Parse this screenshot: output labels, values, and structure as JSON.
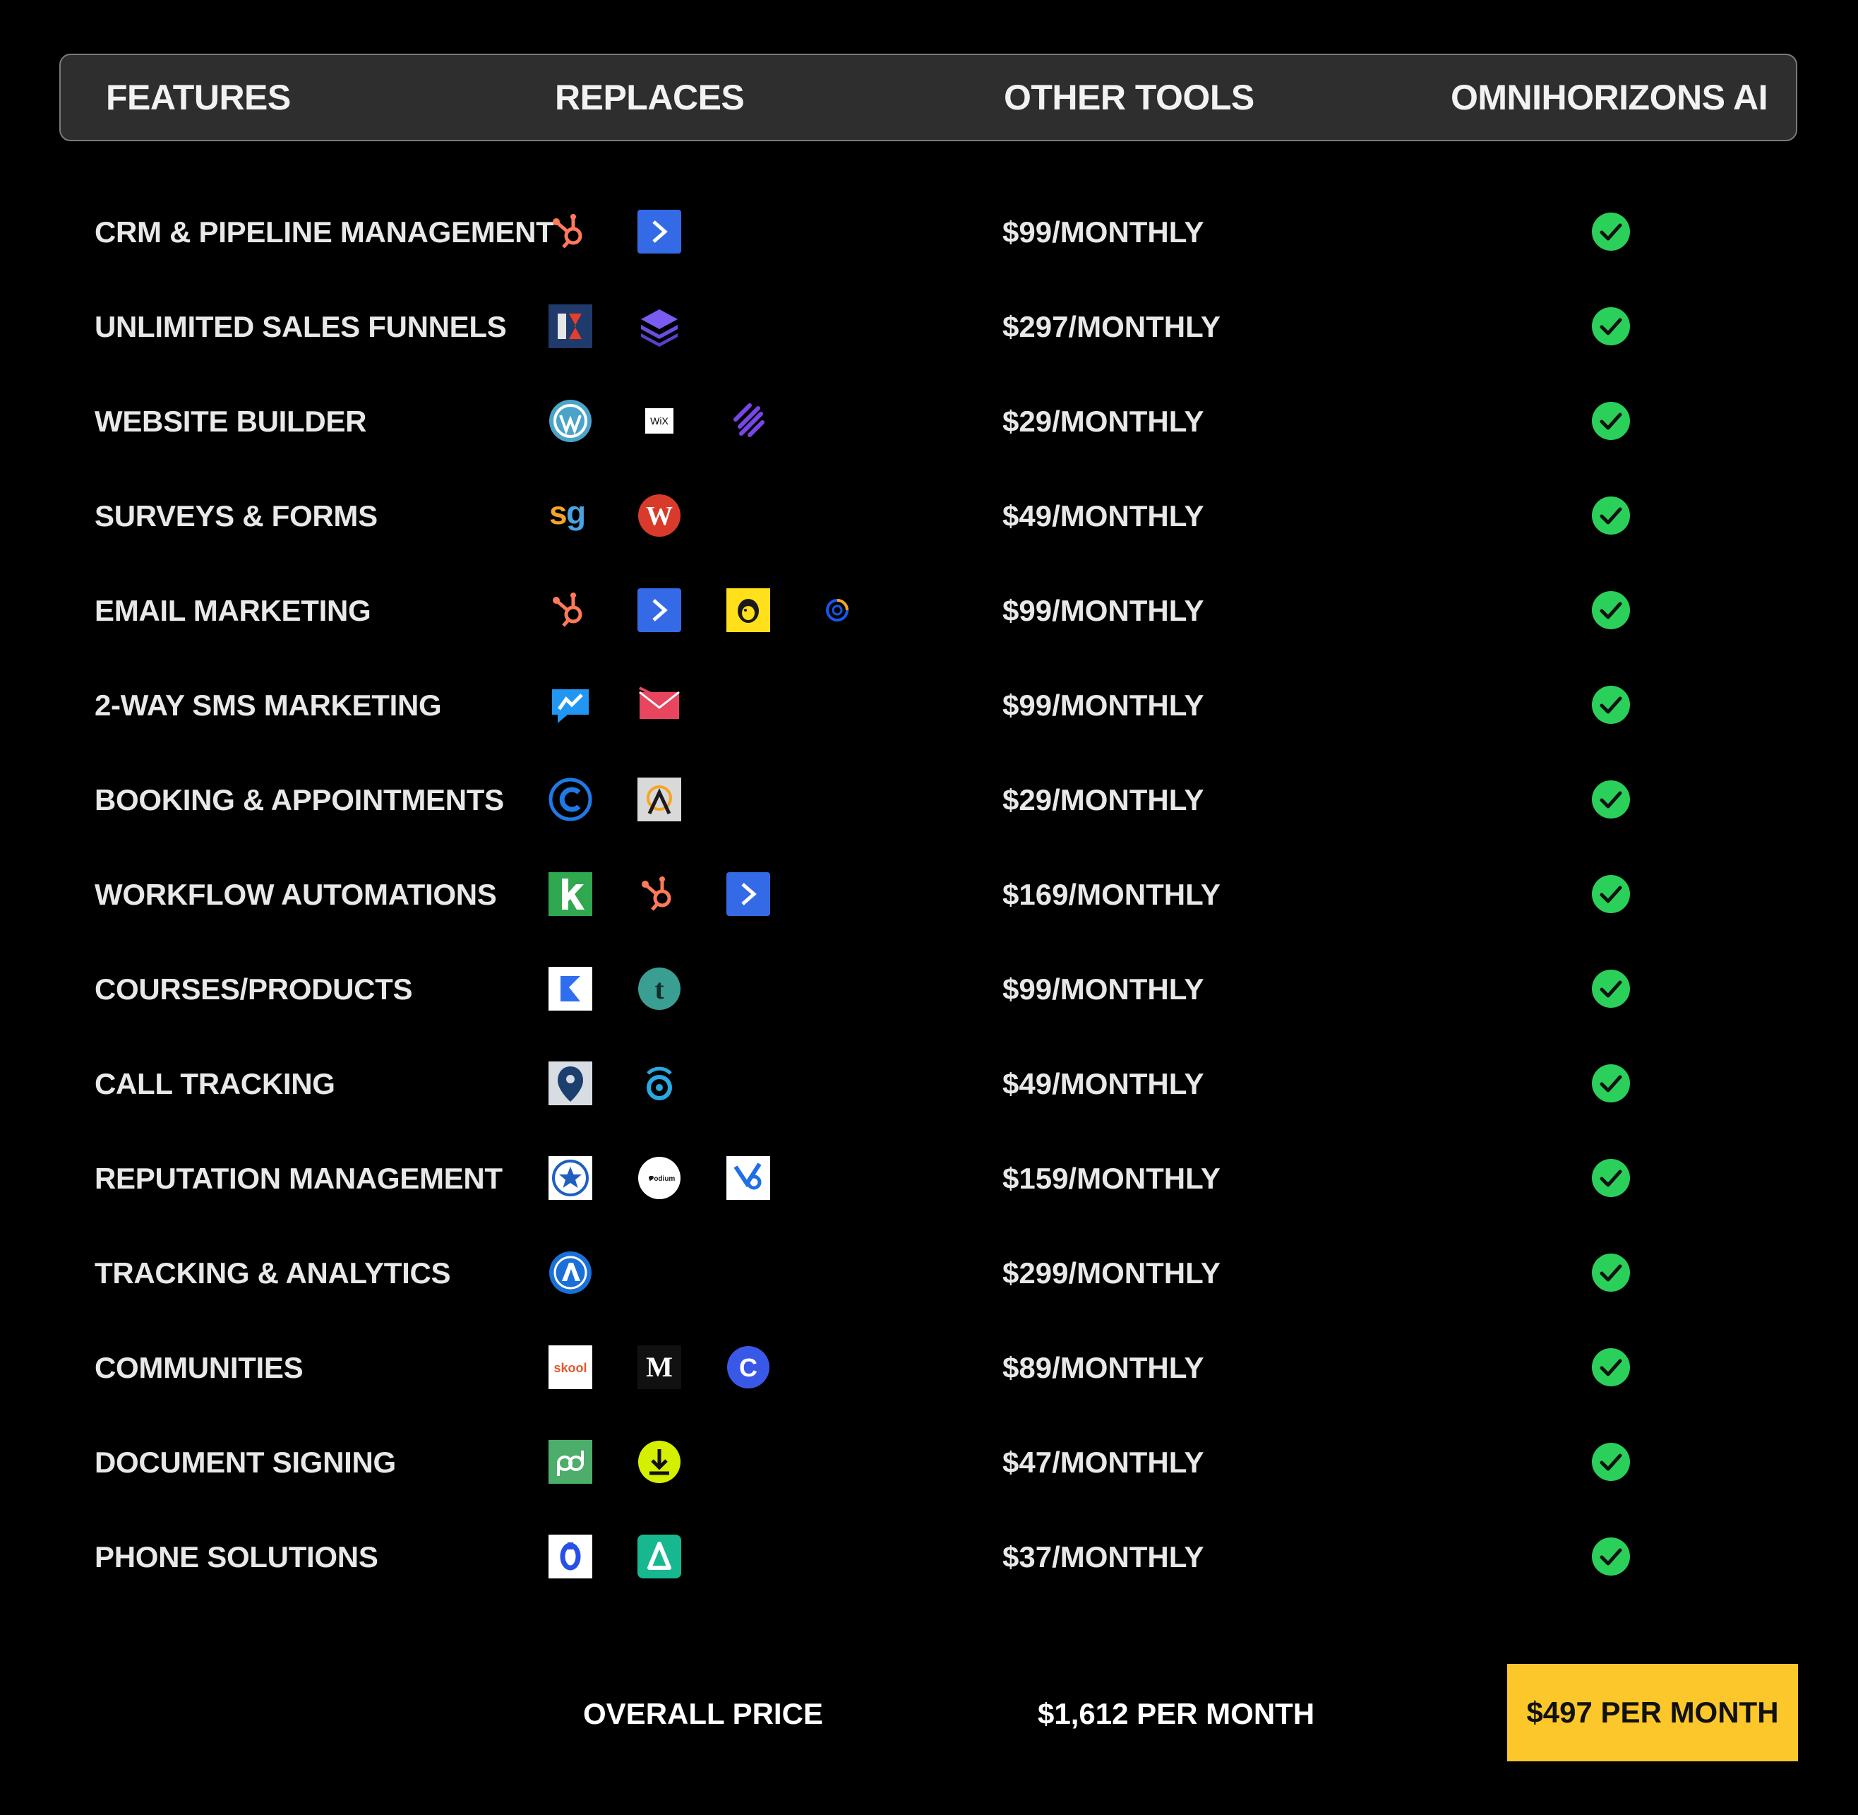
{
  "header": {
    "features": "FEATURES",
    "replaces": "REPLACES",
    "other_tools": "OTHER TOOLS",
    "brand": "OMNIHORIZONS AI"
  },
  "rows": [
    {
      "feature": "CRM & PIPELINE MANAGEMENT",
      "price": "$99/MONTHLY",
      "logos": [
        "hubspot-logo",
        "activecampaign-logo"
      ]
    },
    {
      "feature": "UNLIMITED SALES FUNNELS",
      "price": "$297/MONTHLY",
      "logos": [
        "clickfunnels-logo",
        "layers-logo"
      ]
    },
    {
      "feature": "WEBSITE BUILDER",
      "price": "$29/MONTHLY",
      "logos": [
        "wordpress-logo",
        "wix-logo",
        "squarespace-logo"
      ]
    },
    {
      "feature": "SURVEYS & FORMS",
      "price": "$49/MONTHLY",
      "logos": [
        "surveygizmo-logo",
        "wufoo-logo"
      ]
    },
    {
      "feature": "EMAIL MARKETING",
      "price": "$99/MONTHLY",
      "logos": [
        "hubspot-logo",
        "activecampaign-logo",
        "mailchimp-logo",
        "constantcontact-logo"
      ]
    },
    {
      "feature": "2-WAY SMS MARKETING",
      "price": "$99/MONTHLY",
      "logos": [
        "sms-chat-logo",
        "envelope-logo"
      ]
    },
    {
      "feature": "BOOKING & APPOINTMENTS",
      "price": "$29/MONTHLY",
      "logos": [
        "calendly-logo",
        "acuity-logo"
      ]
    },
    {
      "feature": "WORKFLOW AUTOMATIONS",
      "price": "$169/MONTHLY",
      "logos": [
        "keap-logo",
        "hubspot-logo",
        "activecampaign-logo"
      ]
    },
    {
      "feature": "COURSES/PRODUCTS",
      "price": "$99/MONTHLY",
      "logos": [
        "kajabi-logo",
        "teachable-logo"
      ]
    },
    {
      "feature": "CALL TRACKING",
      "price": "$49/MONTHLY",
      "logos": [
        "callrail-logo",
        "calltracking-ring-logo"
      ]
    },
    {
      "feature": "REPUTATION MANAGEMENT",
      "price": "$159/MONTHLY",
      "logos": [
        "star-badge-logo",
        "podium-logo",
        "birdeye-logo"
      ]
    },
    {
      "feature": "TRACKING & ANALYTICS",
      "price": "$299/MONTHLY",
      "logos": [
        "analytics-badge-logo"
      ]
    },
    {
      "feature": "COMMUNITIES",
      "price": "$89/MONTHLY",
      "logos": [
        "skool-logo",
        "medium-logo",
        "circle-logo"
      ]
    },
    {
      "feature": "DOCUMENT SIGNING",
      "price": "$47/MONTHLY",
      "logos": [
        "pandadoc-logo",
        "download-logo"
      ]
    },
    {
      "feature": "PHONE SOLUTIONS",
      "price": "$37/MONTHLY",
      "logos": [
        "dialpad-logo",
        "aircall-logo"
      ]
    }
  ],
  "logo_text": {
    "wix": "WiX",
    "sg": "sg",
    "skool": "skool",
    "medium": "M",
    "teachable": "t",
    "podium": "Podium",
    "wufoo": "W",
    "circle": "C"
  },
  "footer": {
    "label": "OVERALL PRICE",
    "other_total": "$1,612 PER MONTH",
    "cta": "$497 PER MONTH"
  },
  "colors": {
    "background": "#000000",
    "header_bg": "#2e2e2e",
    "check_green": "#2bd05a",
    "cta_yellow": "#fcc72b"
  }
}
